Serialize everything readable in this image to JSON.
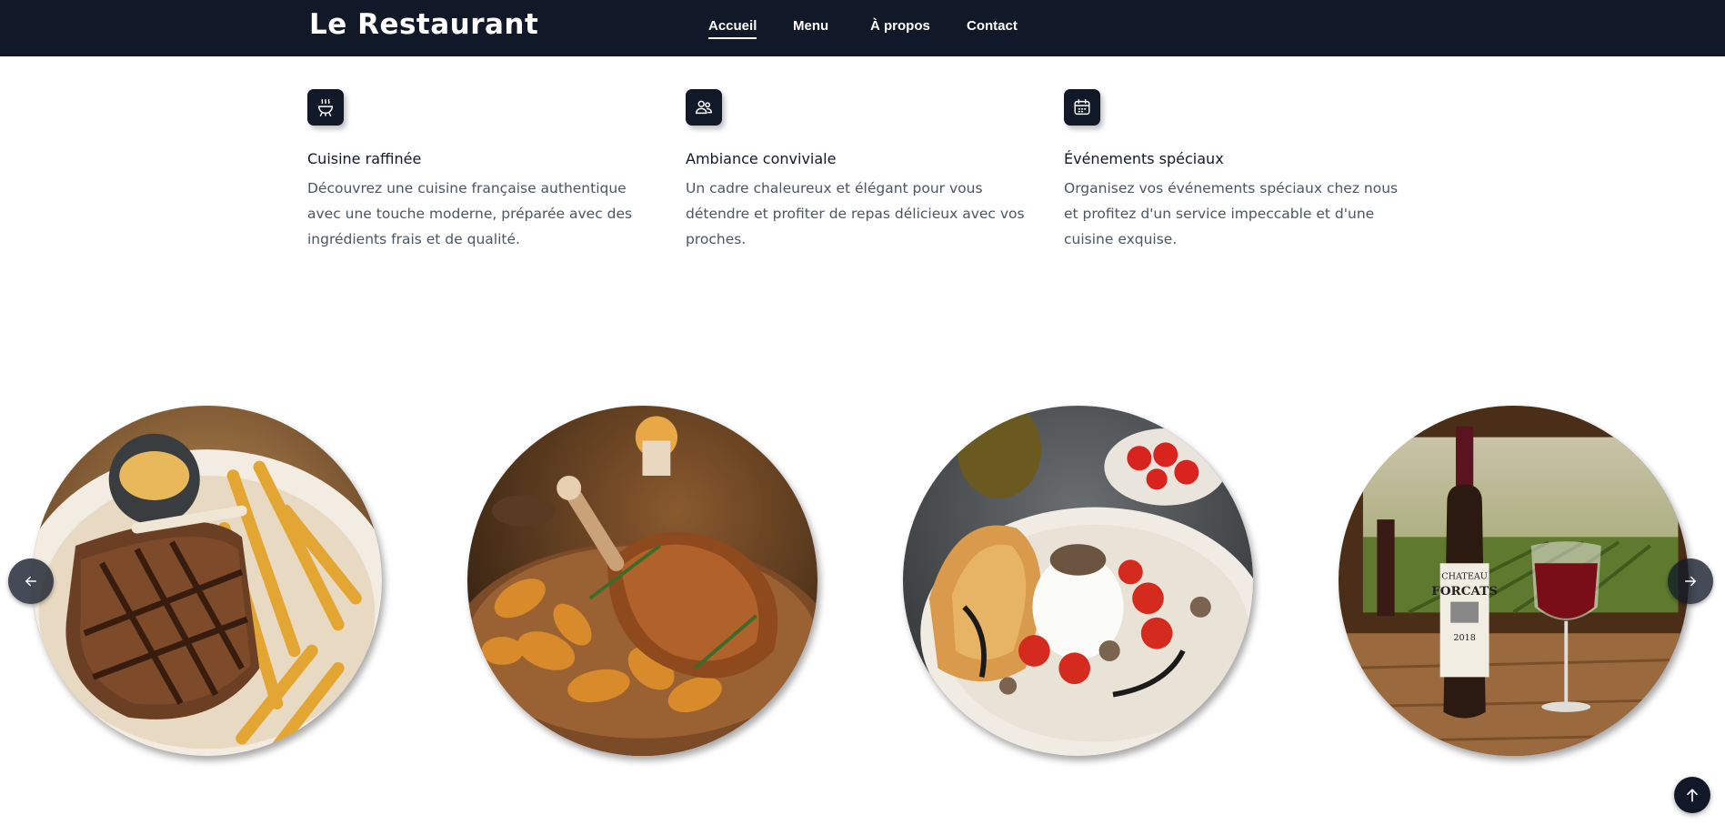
{
  "header": {
    "brand": "Le Restaurant",
    "nav": [
      {
        "label": "Accueil",
        "active": true
      },
      {
        "label": "Menu",
        "active": false
      },
      {
        "label": "À propos",
        "active": false
      },
      {
        "label": "Contact",
        "active": false
      }
    ]
  },
  "features": [
    {
      "icon": "grill-icon",
      "title": "Cuisine raffinée",
      "description": "Découvrez une cuisine française authentique avec une touche moderne, préparée avec des ingrédients frais et de qualité."
    },
    {
      "icon": "people-icon",
      "title": "Ambiance conviviale",
      "description": "Un cadre chaleureux et élégant pour vous détendre et profiter de repas délicieux avec vos proches."
    },
    {
      "icon": "calendar-icon",
      "title": "Événements spéciaux",
      "description": "Organisez vos événements spéciaux chez nous et profitez d'un service impeccable et d'une cuisine exquise."
    }
  ],
  "carousel": {
    "items": [
      {
        "name": "steak-frites-image"
      },
      {
        "name": "roast-duck-potatoes-image"
      },
      {
        "name": "burrata-truffle-image"
      },
      {
        "name": "red-wine-image",
        "label_line1": "CHATEAU",
        "label_line2": "FORCATS",
        "label_year": "2018"
      }
    ],
    "prev_icon": "arrow-left-icon",
    "next_icon": "arrow-right-icon"
  },
  "scroll_top_icon": "arrow-up-icon",
  "colors": {
    "navy": "#111827",
    "text_muted": "#4b5563"
  }
}
